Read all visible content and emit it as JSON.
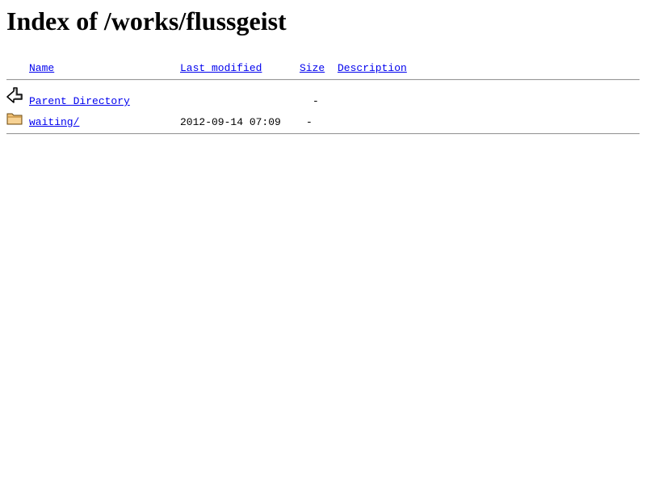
{
  "page": {
    "title": "Index of /works/flussgeist"
  },
  "columns": {
    "name": "Name",
    "last_modified": "Last modified",
    "size": "Size",
    "description": "Description"
  },
  "rows": [
    {
      "icon": "back-arrow-icon",
      "name": "Parent Directory",
      "last_modified": "",
      "size": "-",
      "description": ""
    },
    {
      "icon": "folder-icon",
      "name": "waiting/",
      "last_modified": "2012-09-14 07:09",
      "size": "-",
      "description": ""
    }
  ],
  "colors": {
    "link": "#0000ee",
    "rule": "#9a9a9a"
  }
}
